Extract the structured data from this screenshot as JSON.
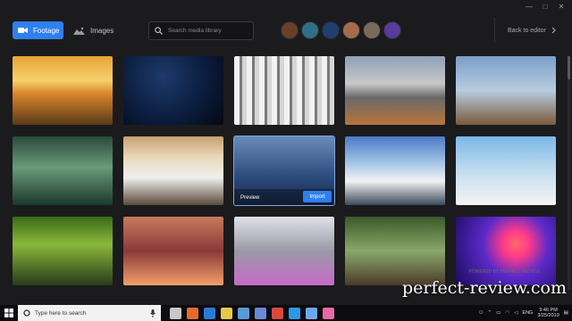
{
  "window": {
    "controls": [
      "—",
      "□",
      "✕"
    ]
  },
  "tabs": {
    "footage_label": "Footage",
    "images_label": "Images"
  },
  "search": {
    "placeholder": "Search media library"
  },
  "avatars": [
    {
      "name": "avatar-1",
      "color": "#6a3f2a"
    },
    {
      "name": "avatar-2",
      "color": "#2f6f86"
    },
    {
      "name": "avatar-3",
      "color": "#1f3f6f"
    },
    {
      "name": "avatar-4",
      "color": "#a56b4c"
    },
    {
      "name": "avatar-5",
      "color": "#7a6a5a"
    },
    {
      "name": "avatar-6",
      "color": "#5a3a9a"
    }
  ],
  "back_label": "Back to editor",
  "hover": {
    "preview_label": "Preview",
    "import_label": "Import"
  },
  "media": [
    {
      "name": "sunset-clouds",
      "bg": "linear-gradient(180deg,#e9a23b 0%,#f6d26a 35%,#d9842a 55%,#5a3a1a 100%)"
    },
    {
      "name": "starry-night",
      "bg": "radial-gradient(circle at 40% 30%,#1c3a6a 0%,#0a1a3a 60%,#05080f 100%)"
    },
    {
      "name": "icicles",
      "bg": "repeating-linear-gradient(90deg,#f2f2f2 0 6px,#7a7a7a 6px 9px,#d6d6d6 9px 14px)"
    },
    {
      "name": "mountain-valley",
      "bg": "linear-gradient(180deg,#8fa0b8 0%,#c8c8c8 40%,#6a6a6a 60%,#b8743a 100%)"
    },
    {
      "name": "cliff-person",
      "bg": "linear-gradient(180deg,#7a9ec8 0%,#b8cce0 50%,#7a5a3a 100%)"
    },
    {
      "name": "ocean-wave",
      "bg": "linear-gradient(180deg,#2a4a3a 0%,#6a9a7a 45%,#1a3a2a 100%)"
    },
    {
      "name": "snowy-forest-sunrise",
      "bg": "linear-gradient(180deg,#c8a070 0%,#e8d8b8 30%,#f0f0f0 60%,#5a4a3a 100%)"
    },
    {
      "name": "ski-lift",
      "bg": "linear-gradient(180deg,#6a8ab8 0%,#2a4a7a 60%,#1a2a4a 100%)"
    },
    {
      "name": "snowy-ski-slope",
      "bg": "linear-gradient(180deg,#4a7ac8 0%,#a8c8e8 40%,#f2f2f2 65%,#3a4a5a 100%)"
    },
    {
      "name": "snowy-plain",
      "bg": "linear-gradient(180deg,#7ab8e8 0%,#c8e0f0 55%,#f4f4f4 100%)"
    },
    {
      "name": "creek",
      "bg": "linear-gradient(180deg,#3a6a1a 0%,#8ab83a 40%,#2a3a1a 100%)"
    },
    {
      "name": "pink-mountains",
      "bg": "linear-gradient(180deg,#c87a5a 0%,#8a3a3a 50%,#f2a06a 100%)"
    },
    {
      "name": "purple-valley",
      "bg": "linear-gradient(180deg,#e0e0e8 0%,#9a9aa8 50%,#c86ac8 100%)"
    },
    {
      "name": "mossy-waterfall",
      "bg": "linear-gradient(180deg,#3a5a2a 0%,#8aa86a 50%,#4a3a2a 100%)"
    },
    {
      "name": "retro-sun-grid",
      "bg": "radial-gradient(circle at 60% 40%,#ff6a6a 0%,#ff3a8a 18%,#5a2ac8 45%,#1a0a5a 100%)"
    }
  ],
  "watermark": "perfect-review.com",
  "watermark_sub": "POWERED BY PERFECT REVIEW",
  "taskbar": {
    "search_placeholder": "Type here to search",
    "icons": [
      {
        "name": "task-view-icon",
        "color": "#c8c8c8"
      },
      {
        "name": "firefox-icon",
        "color": "#e86a2a"
      },
      {
        "name": "edge-icon",
        "color": "#2a7ad8"
      },
      {
        "name": "file-explorer-icon",
        "color": "#e8c84a"
      },
      {
        "name": "store-icon",
        "color": "#5a9ad8"
      },
      {
        "name": "mail-icon",
        "color": "#6a8ad8"
      },
      {
        "name": "chrome-icon",
        "color": "#d84a3a"
      },
      {
        "name": "skype-icon",
        "color": "#2a9ae8"
      },
      {
        "name": "camtasia-icon",
        "color": "#6aa8e8"
      },
      {
        "name": "paint-icon",
        "color": "#e86aa8"
      }
    ],
    "tray": {
      "lang": "ENG",
      "time": "9:46 PM",
      "date": "3/25/2019"
    }
  }
}
